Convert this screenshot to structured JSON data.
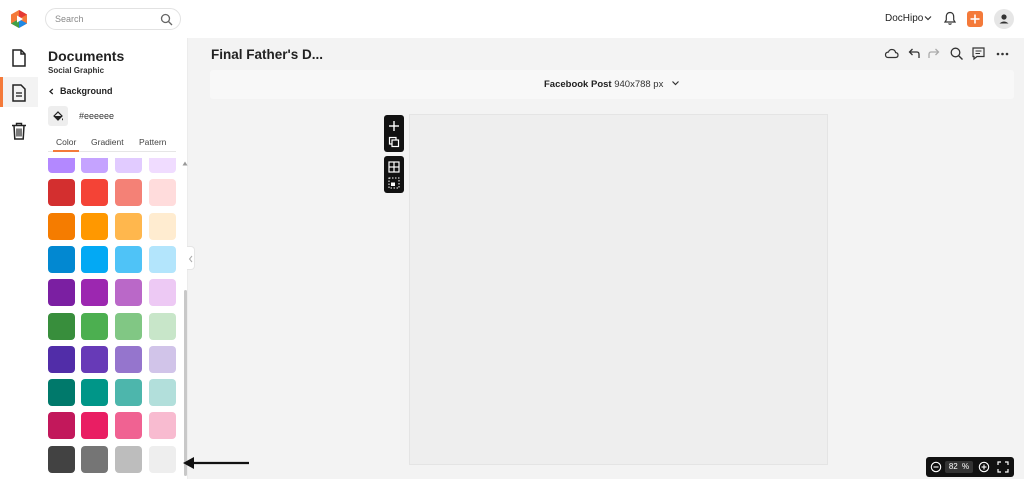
{
  "header": {
    "search_placeholder": "Search",
    "brand_label": "DocHipo"
  },
  "panel": {
    "title": "Documents",
    "subtitle": "Social Graphic",
    "back_label": "Background",
    "hex_value": "#eeeeee",
    "tabs": [
      "Color",
      "Gradient",
      "Pattern"
    ],
    "active_tab": "Color",
    "swatch_rows": [
      [
        "#b388ff",
        "#c5a3ff",
        "#e1cbff",
        "#f0dcff"
      ],
      [
        "#d32f2f",
        "#f44336",
        "#f48176",
        "#ffdcdc"
      ],
      [
        "#f57c00",
        "#ff9800",
        "#ffb74d",
        "#ffecd0"
      ],
      [
        "#0288d1",
        "#03a9f4",
        "#4fc3f7",
        "#b3e5fc"
      ],
      [
        "#7b1fa2",
        "#9c27b0",
        "#ba68c8",
        "#edc9f4"
      ],
      [
        "#388e3c",
        "#4caf50",
        "#81c784",
        "#c8e6c9"
      ],
      [
        "#512da8",
        "#673ab7",
        "#9575cd",
        "#d1c4e9"
      ],
      [
        "#00796b",
        "#009688",
        "#4db6ac",
        "#b2dfdb"
      ],
      [
        "#c2185b",
        "#e91e63",
        "#f06292",
        "#f8bbd0"
      ],
      [
        "#424242",
        "#757575",
        "#bdbdbd",
        "#eeeeee"
      ]
    ]
  },
  "editor": {
    "doc_title": "Final Father's D...",
    "size_label": "Facebook Post",
    "size_value": "940x788 px",
    "canvas_color": "#eeeeee"
  },
  "zoom": {
    "value": "82",
    "unit": "%"
  },
  "colors": {
    "accent": "#f47a3a"
  }
}
